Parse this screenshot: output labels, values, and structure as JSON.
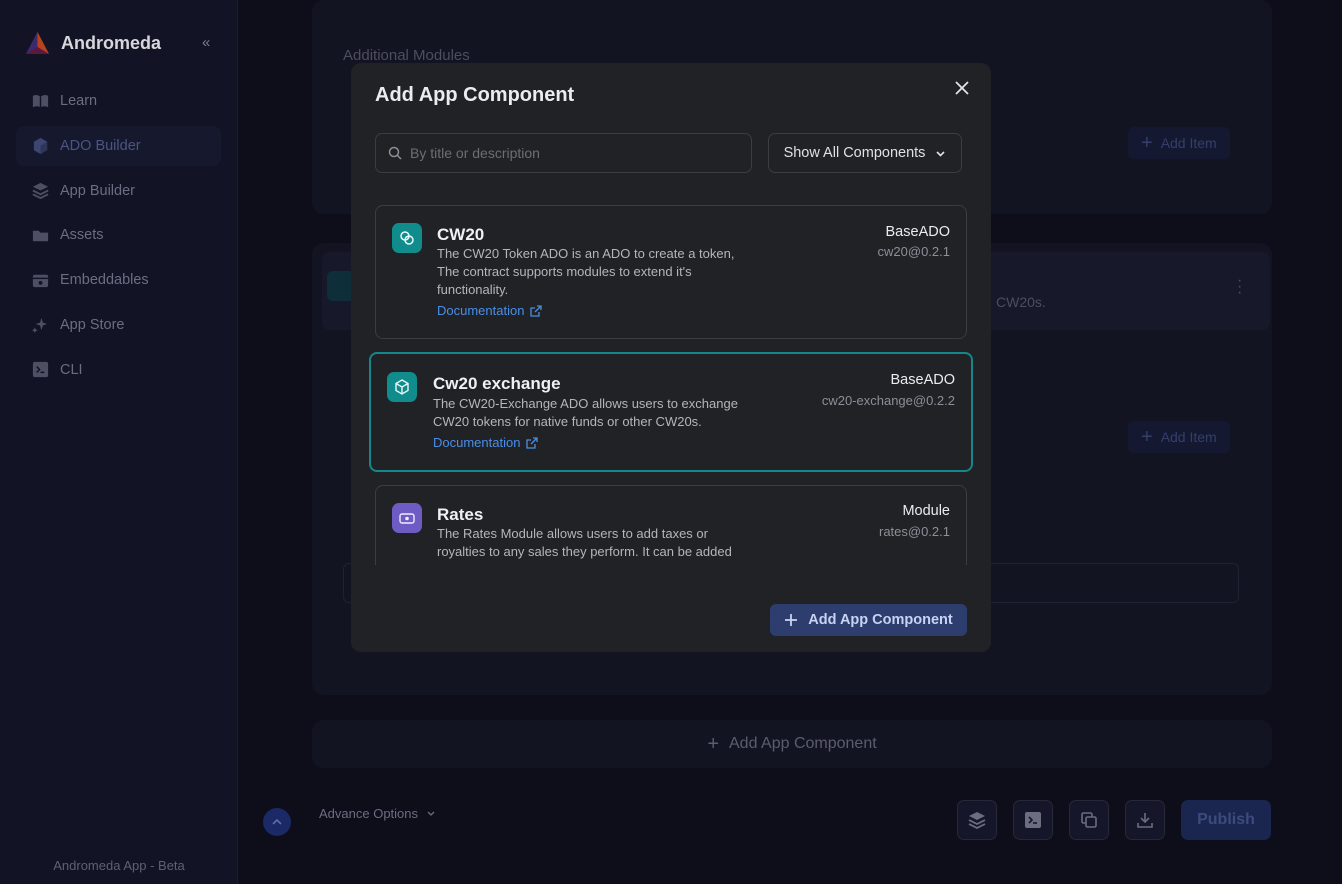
{
  "sidebar": {
    "brand": "Andromeda",
    "items": [
      {
        "label": "Learn",
        "icon": "book-icon"
      },
      {
        "label": "ADO Builder",
        "icon": "cube-icon",
        "active": true
      },
      {
        "label": "App Builder",
        "icon": "layers-icon"
      },
      {
        "label": "Assets",
        "icon": "folder-icon"
      },
      {
        "label": "Embeddables",
        "icon": "embed-icon"
      },
      {
        "label": "App Store",
        "icon": "sparkle-icon"
      },
      {
        "label": "CLI",
        "icon": "terminal-icon"
      }
    ],
    "footer": "Andromeda App - Beta"
  },
  "background": {
    "additional_modules": "Additional Modules",
    "add_item": "Add Item",
    "add_item_2": "Add Item",
    "cw20s_fragment": "CW20s.",
    "add_app_component": "Add App Component",
    "advance_options": "Advance Options",
    "publish": "Publish"
  },
  "modal": {
    "title": "Add App Component",
    "search_placeholder": "By title or description",
    "filter_label": "Show All Components",
    "components": [
      {
        "title": "CW20",
        "description": "The CW20 Token ADO is an ADO to create a token, The contract supports modules to extend it's functionality.",
        "doc_label": "Documentation",
        "type": "BaseADO",
        "version": "cw20@0.2.1"
      },
      {
        "title": "Cw20 exchange",
        "description": "The CW20-Exchange ADO allows users to exchange CW20 tokens for native funds or other CW20s.",
        "doc_label": "Documentation",
        "type": "BaseADO",
        "version": "cw20-exchange@0.2.2"
      },
      {
        "title": "Rates",
        "description": "The Rates Module allows users to add taxes or royalties to any sales they perform. It can be added",
        "type": "Module",
        "version": "rates@0.2.1"
      }
    ],
    "add_button": "Add App Component"
  },
  "colors": {
    "accent_teal": "#14878a",
    "link_blue": "#4a8ee6",
    "module_purple": "#6e5bc4",
    "button_blue": "#2d3d6e"
  }
}
